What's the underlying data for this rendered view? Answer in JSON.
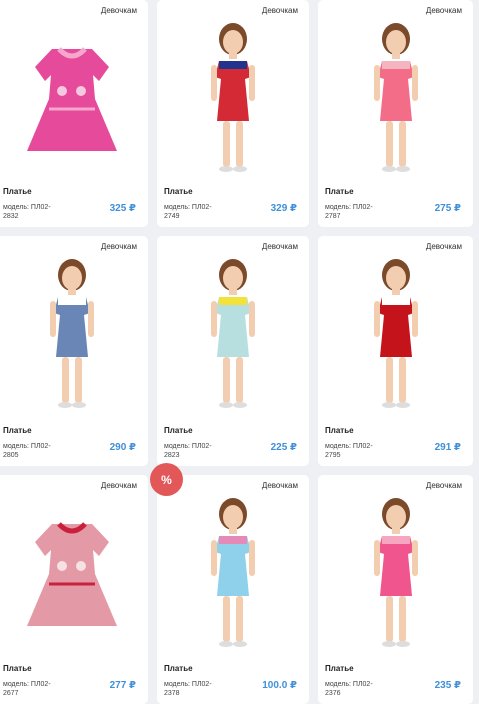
{
  "products": [
    {
      "category": "Девочкам",
      "name": "Платье",
      "model": "модель: ПЛ02-2832",
      "price": "325 ₽",
      "dress": "#e54a9b",
      "accent": "#f7a6cc"
    },
    {
      "category": "Девочкам",
      "name": "Платье",
      "model": "модель: ПЛ02-2749",
      "price": "329 ₽",
      "dress": "#d42a35",
      "accent": "#21338c"
    },
    {
      "category": "Девочкам",
      "name": "Платье",
      "model": "модель: ПЛ02-2787",
      "price": "275 ₽",
      "dress": "#f36c88",
      "accent": "#f4b5c0"
    },
    {
      "category": "Девочкам",
      "name": "Платье",
      "model": "модель: ПЛ02-2805",
      "price": "290 ₽",
      "dress": "#6a86b6",
      "accent": "#ffffff"
    },
    {
      "category": "Девочкам",
      "name": "Платье",
      "model": "модель: ПЛ02-2823",
      "price": "225 ₽",
      "dress": "#b7dfe0",
      "accent": "#f3e23a"
    },
    {
      "category": "Девочкам",
      "name": "Платье",
      "model": "модель: ПЛ02-2795",
      "price": "291 ₽",
      "dress": "#c5131c",
      "accent": "#ffffff"
    },
    {
      "category": "Девочкам",
      "name": "Платье",
      "model": "модель: ПЛ02-2677",
      "price": "277 ₽",
      "dress": "#e39aa6",
      "accent": "#c9213c"
    },
    {
      "category": "Девочкам",
      "name": "Платье",
      "model": "модель: ПЛ02-2378",
      "price": "100.0 ₽",
      "dress": "#8fd0ea",
      "accent": "#e58ab6"
    },
    {
      "category": "Девочкам",
      "name": "Платье",
      "model": "модель: ПЛ02-2376",
      "price": "235 ₽",
      "dress": "#f0558d",
      "accent": "#f7a6c0"
    }
  ],
  "discount_badge": "%"
}
